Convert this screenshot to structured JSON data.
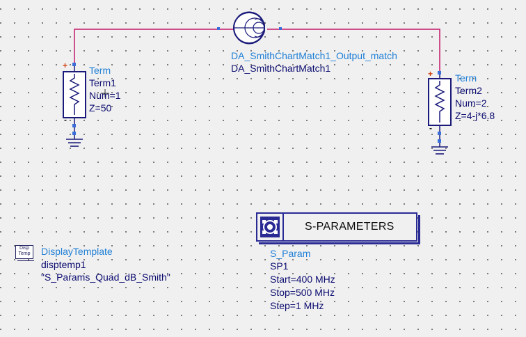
{
  "colors": {
    "wire": "#c2196b",
    "component": "#1a1a7a",
    "label_blue": "#1f7fd6",
    "label_navy": "#0b0b70",
    "pin": "#3b6fd8"
  },
  "term1": {
    "type_label": "Term",
    "instance": "Term1",
    "num": "Num=1",
    "z": "Z=50"
  },
  "term2": {
    "type_label": "Term",
    "instance": "Term2",
    "num": "Num=2",
    "z": "Z=4-j*6.8"
  },
  "smith_match": {
    "type_label": "DA_SmithChartMatch1_Output_match",
    "instance": "DA_SmithChartMatch1"
  },
  "sparams": {
    "block_title": "S-PARAMETERS",
    "type_label": "S_Param",
    "instance": "SP1",
    "start": "Start=400 MHz",
    "stop": "Stop=500 MHz",
    "step": "Step=1 MHz"
  },
  "display_template": {
    "icon_text_line1": "Disp",
    "icon_text_line2": "Temp",
    "type_label": "DisplayTemplate",
    "instance": "disptemp1",
    "template_name": "\"S_Params_Quad_dB_Smith\""
  },
  "pin_signs": {
    "plus": "+",
    "minus": "-"
  }
}
